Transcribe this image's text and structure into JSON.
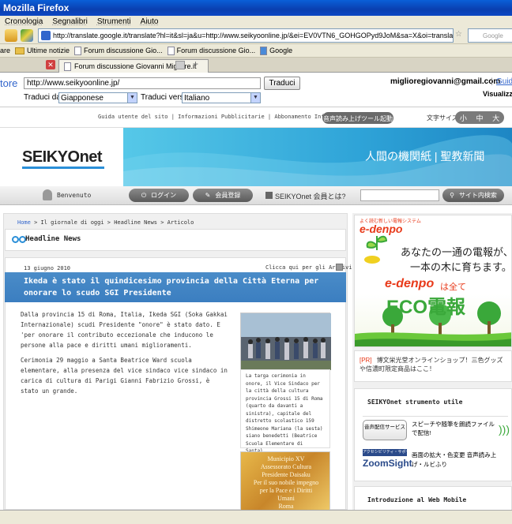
{
  "browser": {
    "title": "Mozilla Firefox",
    "menu": [
      "Cronologia",
      "Segnalibri",
      "Strumenti",
      "Aiuto"
    ],
    "url": "http://translate.google.it/translate?hl=it&sl=ja&u=http://www.seikyoonline.jp/&ei=EV0VTN6_GOHGOPyd9JoM&sa=X&oi=translate&ct=result&resnum",
    "search_placeholder": "Google",
    "bookmarks": [
      "are",
      "Ultime notizie",
      "Forum discussione Gio...",
      "Forum discussione Gio...",
      "Google"
    ],
    "tab_label": "Forum discussione Giovanni Migliore.it"
  },
  "translate_bar": {
    "label": "tore",
    "url_value": "http://www.seikyoonline.jp/",
    "button": "Traduci",
    "from_label": "Traduci da:",
    "from_value": "Giapponese",
    "to_label": "Traduci verso:",
    "to_value": "Italiano",
    "account": "miglioregiovanni@gmail.com",
    "guide_link": "Guida",
    "view_label": "Visualizza"
  },
  "site": {
    "top_links": "Guida utente del sito  |  Informazioni Pubblicitarie  |  Abbonamento Informazioni",
    "audio_button": "音声読み上げツール起動",
    "text_size_label": "文字サイズ",
    "text_sizes": [
      "小",
      "中",
      "大"
    ],
    "logo": "SEIKYOnet",
    "banner_text": "人間の機関紙 | 聖教新聞",
    "welcome": "Benvenuto",
    "login": "ログイン",
    "register": "会員登録",
    "member_question": "SEIKYOnet 会員とは?",
    "site_search": "サイト内検索"
  },
  "article": {
    "breadcrumb_home": "Home",
    "breadcrumb_rest": " > Il giornale di oggi > Headline News > Articolo",
    "section_title": "Headline News",
    "date": "13 giugno 2010",
    "archive_link": "Clicca qui per gli Archivi",
    "headline": "Ikeda è stato il quindicesimo provincia della Città Eterna per onorare lo scudo SGI Presidente",
    "para1": "Dalla provincia 15 di Roma, Italia, Ikeda SGI (Soka Gakkai Internazionale) scudi Presidente \"onore\" è stato dato. E 'per onorare il contributo eccezionale che inducono le persone alla pace e diritti umani miglioramenti.",
    "para2": "Cerimonia 29 maggio a Santa Beatrice Ward scuola elementare, alla presenza del vice sindaco vice sindaco in carica di cultura di Parigi Gianni Fabrizio Grossi, è stato un grande.",
    "caption": "La targa cerimonia in onore, il Vice Sindaco per la città della cultura provincia Grossi 15 di Roma (quarto da davanti a sinistra), capitale del distretto scolastico 159 Shimeone Mariana (la sesta) siano benedetti (Beatrice Scuola Elementare di Santa).",
    "plaque_text": "Municipio XV\nAssessorato Cultura\nPresidente Daisaku\nPer il suo nobile impegno\nper la Pace e i Diritti Umani\nRoma"
  },
  "sidebar": {
    "edenpo_tag": "よく読む新しい電報システム",
    "edenpo_logo": "e-denpo",
    "edenpo_line1": "あなたの一通の電報が、",
    "edenpo_line2": "一本の木に育ちます。",
    "edenpo_sub": "は全て",
    "eco_label": "ECO電報",
    "promo_tag": "[PR]",
    "promo_text": "博文栄光堂オンラインショップ！三色グッズや信濃町限定商品はここ！",
    "tools_title": "SEIKYOnet strumento utile",
    "tool1_badge": "音声配信サービス",
    "tool1_text": "スピーチや随筆を朗読ファイルで配信!",
    "tool2_badge": "アクセシビリティ・サポーター",
    "tool2_logo": "ZoomSight",
    "tool2_text": "画面の拡大・色変更 音声読み上げ・ルビふり",
    "mobile_title": "Introduzione al Web Mobile"
  },
  "colors": {
    "headline_bg": "#3b7ec0",
    "banner": "#2fa4d8",
    "edenpo_red": "#e83a1a",
    "eco_green": "#3aa83a"
  }
}
